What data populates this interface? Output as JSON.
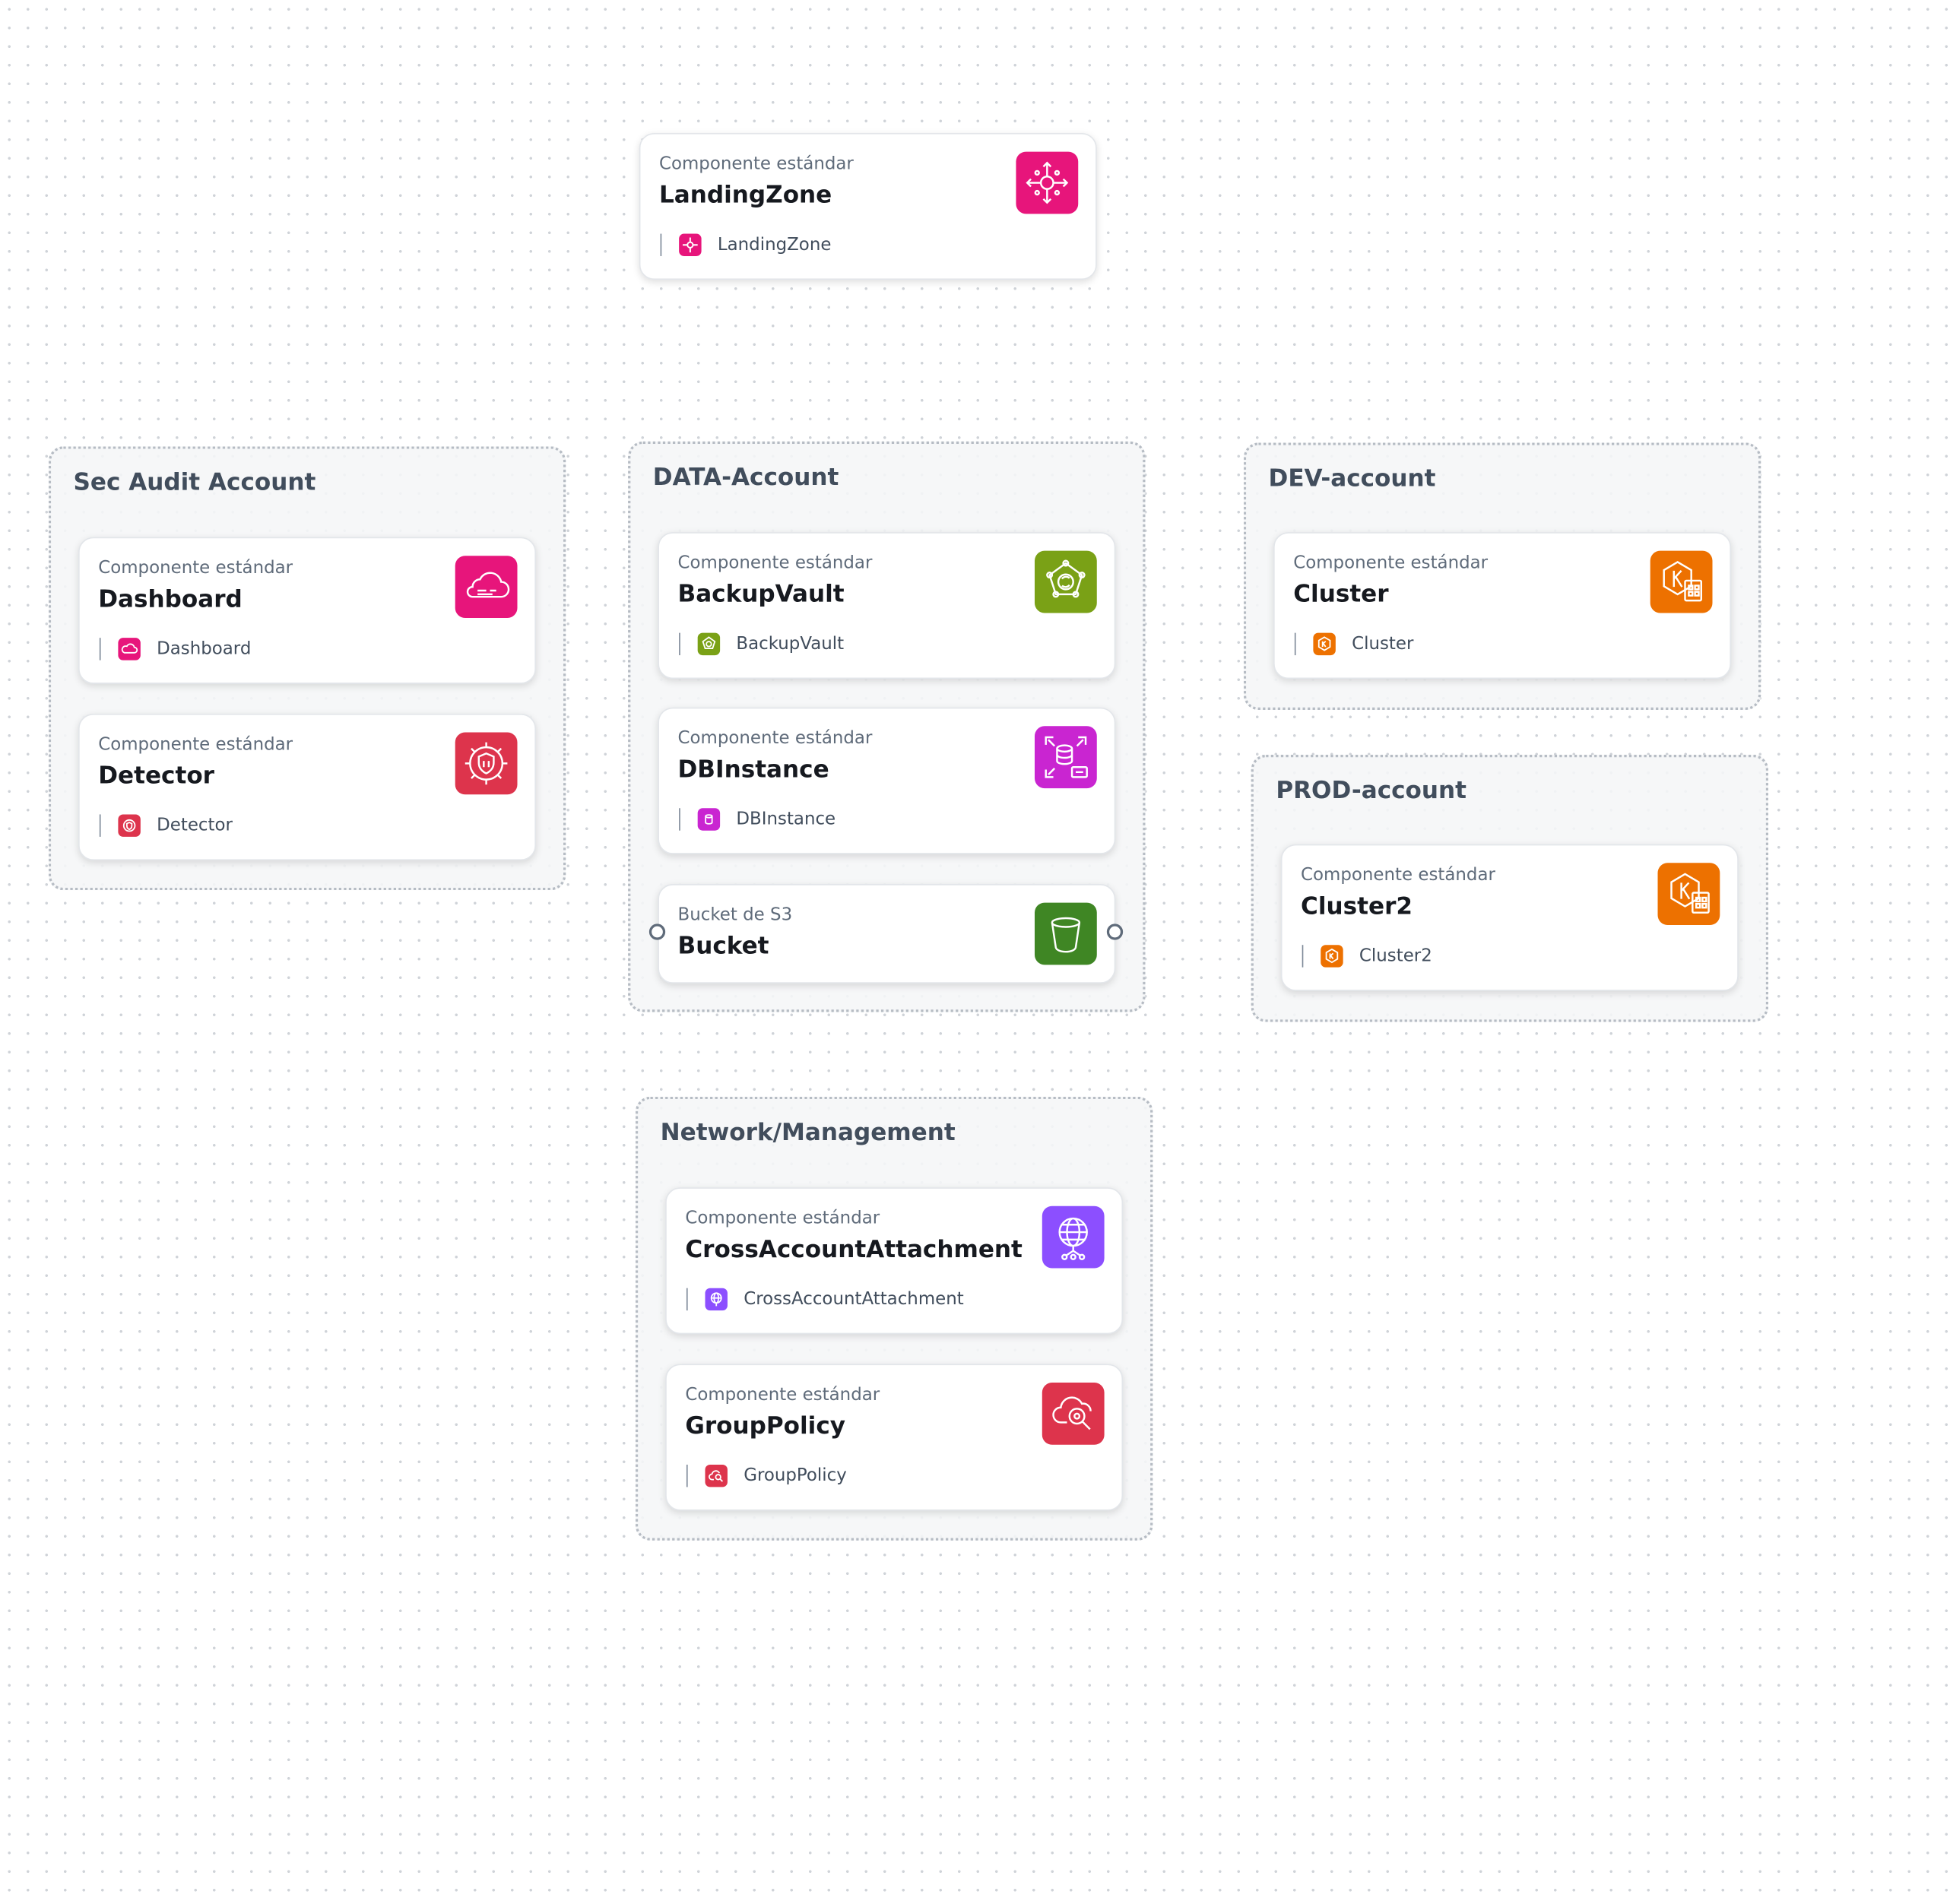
{
  "groups": {
    "sec_audit": {
      "title": "Sec Audit Account"
    },
    "data": {
      "title": "DATA-Account"
    },
    "dev": {
      "title": "DEV-account"
    },
    "prod": {
      "title": "PROD-account"
    },
    "network": {
      "title": "Network/Management"
    }
  },
  "cards": {
    "landing_zone": {
      "type": "Componente estándar",
      "name": "LandingZone",
      "sub": "LandingZone",
      "color": "#e7157b",
      "icon": "landing-zone-icon"
    },
    "dashboard": {
      "type": "Componente estándar",
      "name": "Dashboard",
      "sub": "Dashboard",
      "color": "#e7157b",
      "icon": "dashboard-cloud-icon"
    },
    "detector": {
      "type": "Componente estándar",
      "name": "Detector",
      "sub": "Detector",
      "color": "#dd344c",
      "icon": "detector-shield-gear-icon"
    },
    "backup_vault": {
      "type": "Componente estándar",
      "name": "BackupVault",
      "sub": "BackupVault",
      "color": "#7aa116",
      "icon": "backup-vault-icon"
    },
    "db_instance": {
      "type": "Componente estándar",
      "name": "DBInstance",
      "sub": "DBInstance",
      "color": "#c925d1",
      "icon": "db-instance-icon"
    },
    "bucket": {
      "type": "Bucket de S3",
      "name": "Bucket",
      "color": "#3f8624",
      "icon": "s3-bucket-icon"
    },
    "cluster": {
      "type": "Componente estándar",
      "name": "Cluster",
      "sub": "Cluster",
      "color": "#ed7100",
      "icon": "kubernetes-cluster-icon"
    },
    "cluster2": {
      "type": "Componente estándar",
      "name": "Cluster2",
      "sub": "Cluster2",
      "color": "#ed7100",
      "icon": "kubernetes-cluster-icon"
    },
    "cross_account_attachment": {
      "type": "Componente estándar",
      "name": "CrossAccountAttachment",
      "sub": "CrossAccountAttachment",
      "color": "#8c4fff",
      "icon": "globe-network-icon"
    },
    "group_policy": {
      "type": "Componente estándar",
      "name": "GroupPolicy",
      "sub": "GroupPolicy",
      "color": "#dd344c",
      "icon": "cloud-policy-search-icon"
    }
  }
}
